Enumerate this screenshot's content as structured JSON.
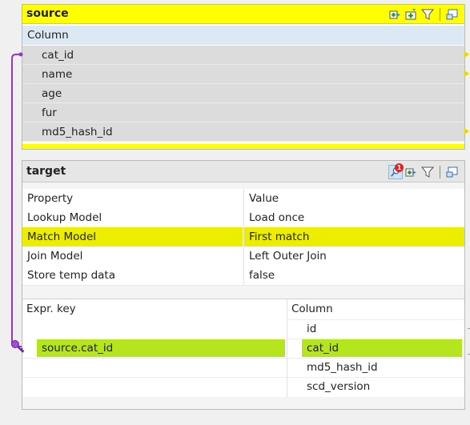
{
  "source": {
    "title": "source",
    "column_header": "Column",
    "fields": [
      "cat_id",
      "name",
      "age",
      "fur",
      "md5_hash_id"
    ]
  },
  "target": {
    "title": "target",
    "properties": {
      "header": {
        "property": "Property",
        "value": "Value"
      },
      "rows": [
        {
          "property": "Lookup Model",
          "value": "Load once"
        },
        {
          "property": "Match Model",
          "value": "First match"
        },
        {
          "property": "Join Model",
          "value": "Left Outer Join"
        },
        {
          "property": "Store temp data",
          "value": "false"
        }
      ]
    },
    "expr_header": "Expr. key",
    "column_header": "Column",
    "expr_keys": [
      "source.cat_id"
    ],
    "columns": [
      "id",
      "cat_id",
      "md5_hash_id",
      "scd_version"
    ],
    "warning_count": "1"
  },
  "colors": {
    "source_header": "#ffff00",
    "highlight_row": "#eded00",
    "match_green": "#b5e61d",
    "link_line": "#9933cc"
  },
  "icons": {
    "source": [
      "add-output-icon",
      "add-input-icon",
      "filter-icon",
      "minimize-icon"
    ],
    "target": [
      "warning-icon",
      "add-output-icon",
      "add-input-icon",
      "filter-icon",
      "minimize-icon"
    ]
  }
}
